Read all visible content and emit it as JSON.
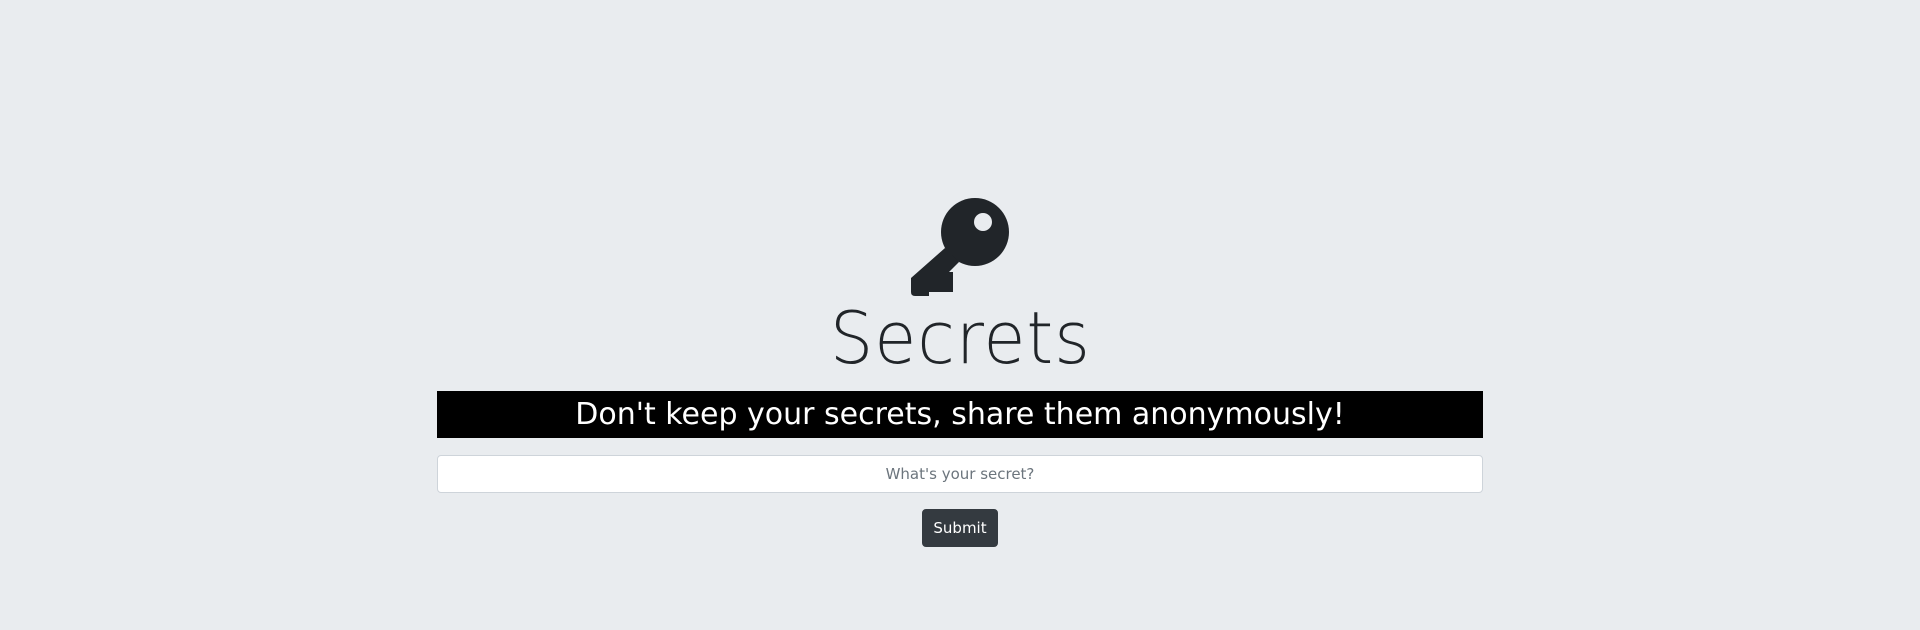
{
  "page": {
    "background_color": "#e9ecef"
  },
  "hero": {
    "icon": "key-icon",
    "icon_color": "#212529",
    "title": "Secrets",
    "tagline": "Don't keep your secrets, share them anonymously!",
    "tagline_bg_color": "#000000",
    "tagline_text_color": "#ffffff"
  },
  "form": {
    "secret_input": {
      "placeholder": "What's your secret?",
      "value": ""
    },
    "submit_label": "Submit",
    "submit_color": "#343a40"
  }
}
